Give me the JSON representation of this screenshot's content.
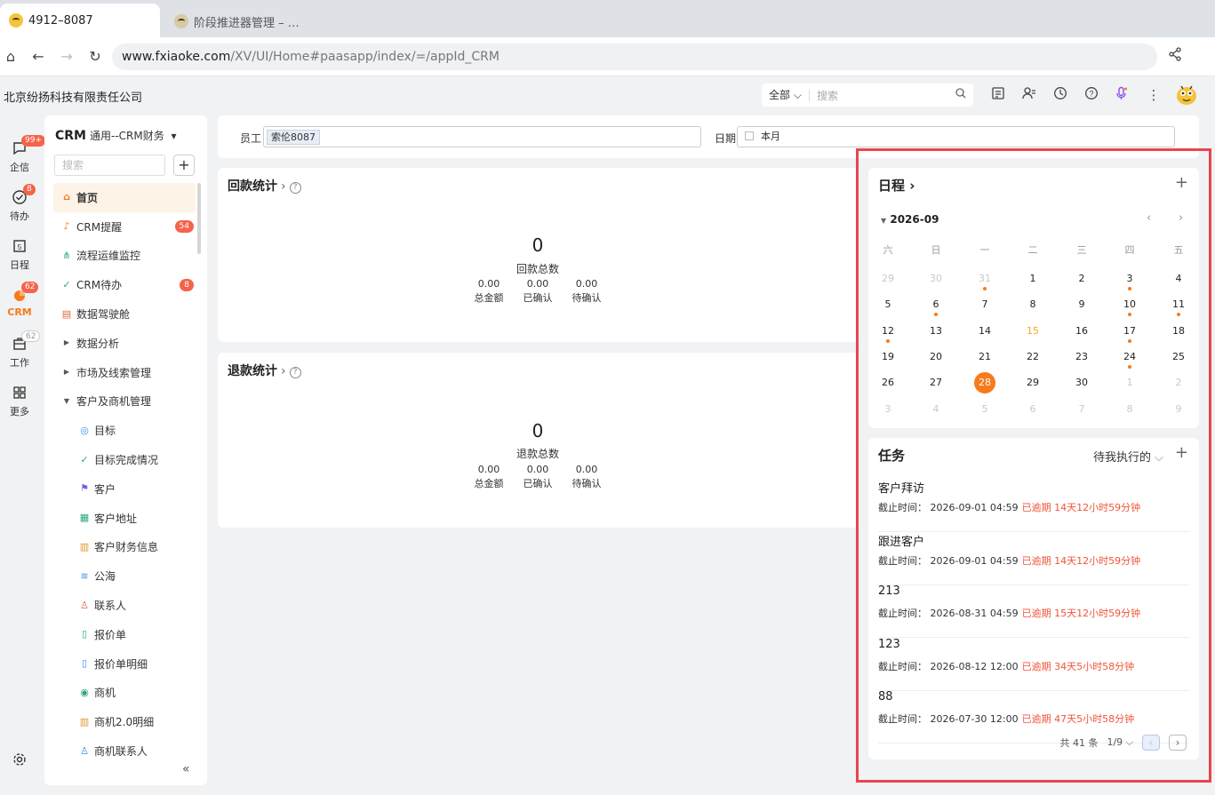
{
  "browser": {
    "tabs": [
      {
        "title": "4912–8087"
      },
      {
        "title": "阶段推进器管理 – …"
      }
    ],
    "url_host": "www.fxiaoke.com",
    "url_path": "/XV/UI/Home#paasapp/index/=/appId_CRM"
  },
  "header": {
    "company": "北京纷扬科技有限责任公司",
    "search_scope": "全部",
    "search_placeholder": "搜索"
  },
  "rail": {
    "items": [
      {
        "label": "企信",
        "badge": "99+"
      },
      {
        "label": "待办",
        "badge": "8"
      },
      {
        "label": "日程",
        "badge": ""
      },
      {
        "label": "CRM",
        "badge": "62"
      },
      {
        "label": "工作",
        "badge": "62"
      },
      {
        "label": "更多",
        "badge": ""
      }
    ]
  },
  "sidebar": {
    "title": "CRM",
    "subtitle": "通用--CRM财务",
    "search_placeholder": "搜索",
    "add": "+",
    "items": [
      {
        "label": "首页",
        "badge": ""
      },
      {
        "label": "CRM提醒",
        "badge": "54"
      },
      {
        "label": "流程运维监控",
        "badge": ""
      },
      {
        "label": "CRM待办",
        "badge": "8"
      },
      {
        "label": "数据驾驶舱",
        "badge": ""
      },
      {
        "label": "数据分析",
        "badge": ""
      },
      {
        "label": "市场及线索管理",
        "badge": ""
      },
      {
        "label": "客户及商机管理",
        "badge": ""
      },
      {
        "label": "目标",
        "badge": ""
      },
      {
        "label": "目标完成情况",
        "badge": ""
      },
      {
        "label": "客户",
        "badge": ""
      },
      {
        "label": "客户地址",
        "badge": ""
      },
      {
        "label": "客户财务信息",
        "badge": ""
      },
      {
        "label": "公海",
        "badge": ""
      },
      {
        "label": "联系人",
        "badge": ""
      },
      {
        "label": "报价单",
        "badge": ""
      },
      {
        "label": "报价单明细",
        "badge": ""
      },
      {
        "label": "商机",
        "badge": ""
      },
      {
        "label": "商机2.0明细",
        "badge": ""
      },
      {
        "label": "商机联系人",
        "badge": ""
      }
    ],
    "collapse": "«"
  },
  "filter": {
    "employee_label": "员工",
    "employee_tag": "索伦8087",
    "date_label": "日期",
    "date_value": "本月"
  },
  "payment": {
    "title": "回款统计",
    "total": "0",
    "total_label": "回款总数",
    "cols": [
      {
        "value": "0.00",
        "label": "总金额"
      },
      {
        "value": "0.00",
        "label": "已确认"
      },
      {
        "value": "0.00",
        "label": "待确认"
      }
    ]
  },
  "refund": {
    "title": "退款统计",
    "total": "0",
    "total_label": "退款总数",
    "cols": [
      {
        "value": "0.00",
        "label": "总金额"
      },
      {
        "value": "0.00",
        "label": "已确认"
      },
      {
        "value": "0.00",
        "label": "待确认"
      }
    ]
  },
  "schedule": {
    "title": "日程",
    "month": "2026-09",
    "weekdays": [
      "六",
      "日",
      "一",
      "二",
      "三",
      "四",
      "五"
    ],
    "rows": [
      [
        "29",
        "30",
        "31",
        "1",
        "2",
        "3",
        "4"
      ],
      [
        "5",
        "6",
        "7",
        "8",
        "9",
        "10",
        "11"
      ],
      [
        "12",
        "13",
        "14",
        "15",
        "16",
        "17",
        "18"
      ],
      [
        "19",
        "20",
        "21",
        "22",
        "23",
        "24",
        "25"
      ],
      [
        "26",
        "27",
        "28",
        "29",
        "30",
        "1",
        "2"
      ],
      [
        "3",
        "4",
        "5",
        "6",
        "7",
        "8",
        "9"
      ]
    ],
    "today": "28",
    "highlight": "15",
    "event_days": [
      "31",
      "3",
      "6",
      "10",
      "11",
      "12",
      "17",
      "24"
    ]
  },
  "tasks": {
    "title": "任务",
    "filter": "待我执行的",
    "due_label": "截止时间：",
    "items": [
      {
        "name": "客户拜访",
        "due": "2026-09-01 04:59",
        "overdue": "已逾期 14天12小时59分钟"
      },
      {
        "name": "跟进客户",
        "due": "2026-09-01 04:59",
        "overdue": "已逾期 14天12小时59分钟"
      },
      {
        "name": "213",
        "due": "2026-08-31 04:59",
        "overdue": "已逾期 15天12小时59分钟"
      },
      {
        "name": "123",
        "due": "2026-08-12 12:00",
        "overdue": "已逾期 34天5小时58分钟"
      },
      {
        "name": "88",
        "due": "2026-07-30 12:00",
        "overdue": "已逾期 47天5小时58分钟"
      }
    ],
    "total": "共 41 条",
    "page": "1/9"
  },
  "colors": {
    "accent": "#f77a1b",
    "highlight_border": "#e8454c",
    "overdue": "#f0553a",
    "badge": "#f5634a"
  }
}
